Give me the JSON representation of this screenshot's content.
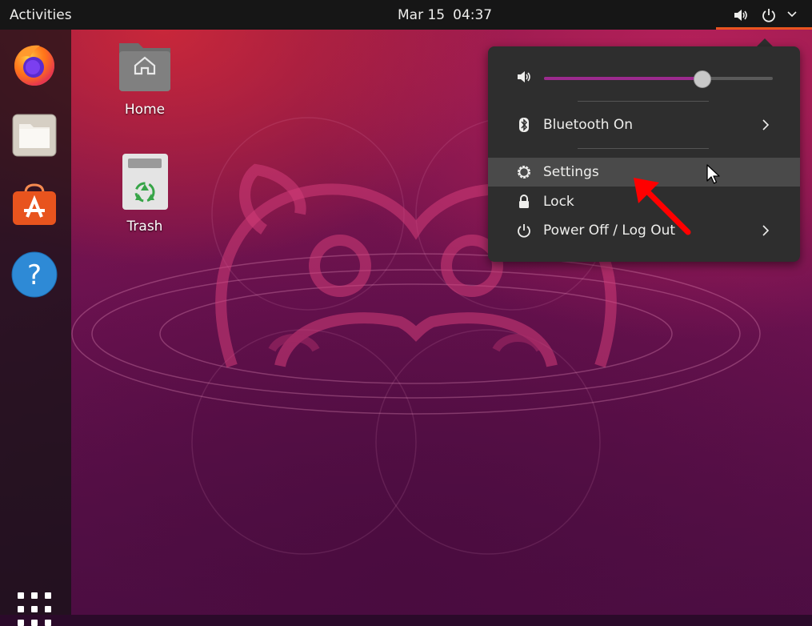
{
  "topbar": {
    "activities_label": "Activities",
    "date": "Mar 15",
    "time": "04:37",
    "icons": [
      "speaker-icon",
      "power-icon",
      "chevron-down-icon"
    ],
    "accent_color": "#e95420"
  },
  "dock": {
    "items": [
      "firefox-icon",
      "files-icon",
      "software-store-icon",
      "help-icon"
    ],
    "show_apps_icon": "apps-grid-icon"
  },
  "desktop": {
    "icons": [
      {
        "label": "Home",
        "icon": "home-folder-icon"
      },
      {
        "label": "Trash",
        "icon": "trash-icon"
      }
    ]
  },
  "system_menu": {
    "volume": {
      "icon": "speaker-icon",
      "level": 0.69,
      "accent_color": "#9c2a8e"
    },
    "bluetooth": {
      "label": "Bluetooth On",
      "icon": "bluetooth-icon"
    },
    "settings": {
      "label": "Settings",
      "icon": "gear-icon",
      "highlighted": true
    },
    "lock": {
      "label": "Lock",
      "icon": "lock-icon"
    },
    "power": {
      "label": "Power Off / Log Out",
      "icon": "power-icon"
    }
  },
  "annotation": {
    "icon": "red-arrow-icon",
    "color": "#ff0000"
  }
}
